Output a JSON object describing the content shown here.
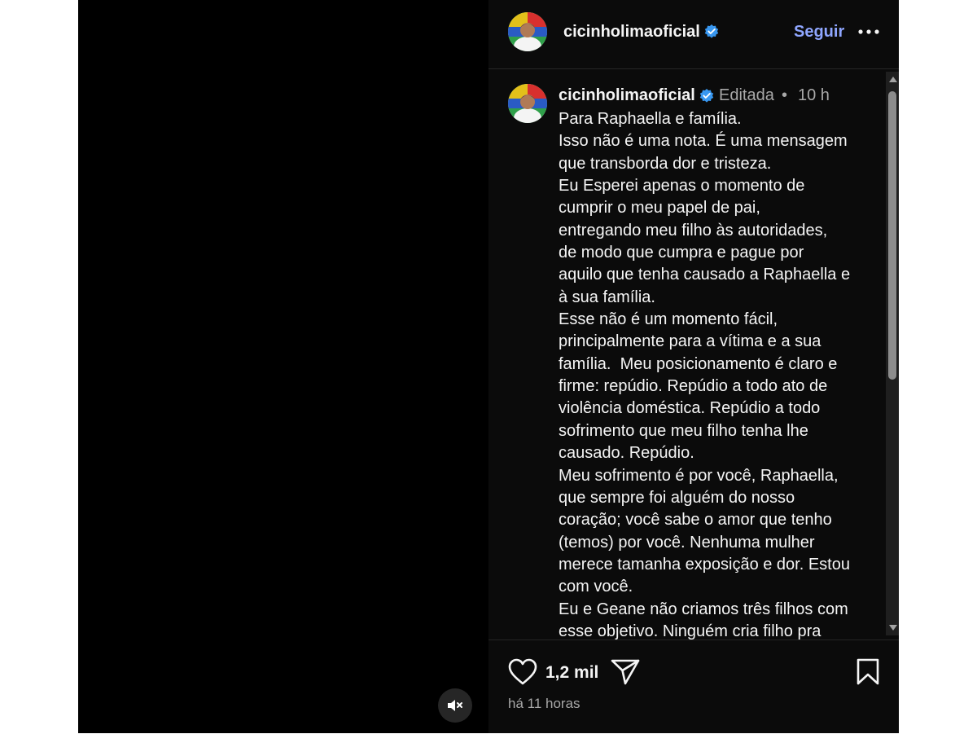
{
  "colors": {
    "background": "#000000",
    "panel": "#0b0b0b",
    "text": "#f5f5f5",
    "muted": "#a8a8a8",
    "follow": "#8fa6ff",
    "verified": "#3897f0"
  },
  "video": {
    "mute_icon": "speaker-muted-icon"
  },
  "header": {
    "username": "cicinholimaoficial",
    "verified_icon": "verified-badge-icon",
    "follow_label": "Seguir",
    "more_icon": "more-options-icon"
  },
  "caption": {
    "username": "cicinholimaoficial",
    "edited": "Editada",
    "separator": "•",
    "time_ago": "10 h",
    "lines": [
      "Para Raphaella e família.",
      "Isso não é uma nota. É uma mensagem",
      "que transborda dor e tristeza.",
      "Eu Esperei apenas o momento de",
      "cumprir o meu papel de pai,",
      "entregando meu filho às autoridades,",
      "de modo que cumpra e pague por",
      "aquilo que tenha causado a Raphaella e",
      "à sua família.",
      "Esse não é um momento fácil,",
      "principalmente para a vítima e a sua",
      "família.  Meu posicionamento é claro e",
      "firme: repúdio. Repúdio a todo ato de",
      "violência doméstica. Repúdio a todo",
      "sofrimento que meu filho tenha lhe",
      "causado. Repúdio.",
      "Meu sofrimento é por você, Raphaella,",
      "que sempre foi alguém do nosso",
      "coração; você sabe o amor que tenho",
      "(temos) por você. Nenhuma mulher",
      "merece tamanha exposição e dor. Estou",
      "com você.",
      "Eu e Geane não criamos três filhos com",
      "esse objetivo. Ninguém cria filho pra"
    ]
  },
  "actions": {
    "like_icon": "heart-icon",
    "like_count": "1,2 mil",
    "share_icon": "send-icon",
    "save_icon": "bookmark-icon",
    "posted": "há 11 horas"
  }
}
